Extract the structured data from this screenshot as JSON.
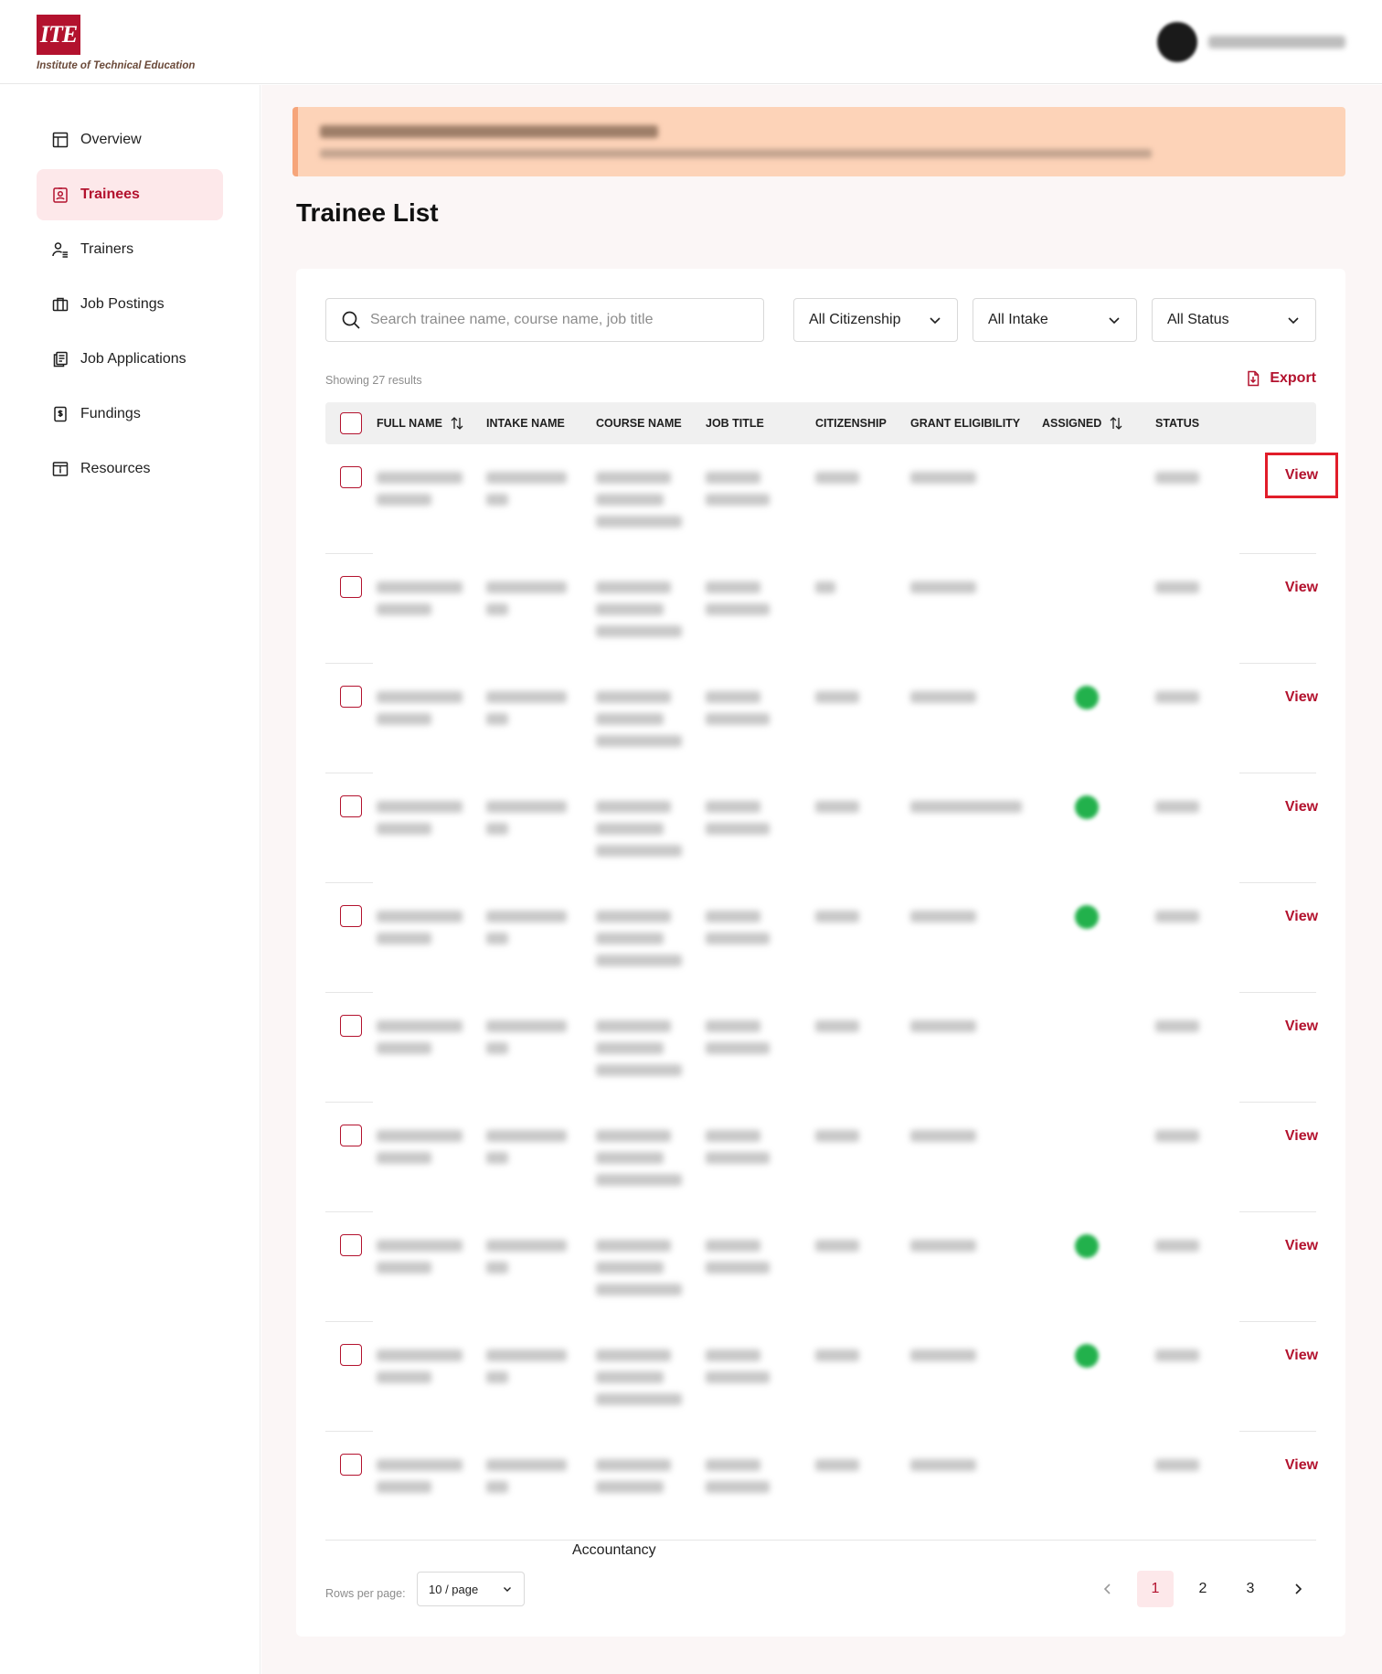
{
  "brand": {
    "logo_text": "ITE",
    "subtitle": "Institute of Technical Education",
    "accent": "#b3122e"
  },
  "sidebar": {
    "items": [
      {
        "label": "Overview",
        "icon": "layout-icon",
        "active": false
      },
      {
        "label": "Trainees",
        "icon": "id-badge-icon",
        "active": true
      },
      {
        "label": "Trainers",
        "icon": "user-list-icon",
        "active": false
      },
      {
        "label": "Job Postings",
        "icon": "briefcase-icon",
        "active": false
      },
      {
        "label": "Job Applications",
        "icon": "documents-icon",
        "active": false
      },
      {
        "label": "Fundings",
        "icon": "dollar-document-icon",
        "active": false
      },
      {
        "label": "Resources",
        "icon": "info-board-icon",
        "active": false
      }
    ]
  },
  "main": {
    "title": "Trainee List",
    "search": {
      "placeholder": "Search trainee name, course name, job title",
      "value": ""
    },
    "filters": [
      "All Citizenship",
      "All Intake",
      "All Status"
    ],
    "showing": "Showing 27 results",
    "export_label": "Export",
    "columns": [
      "Full Name",
      "Intake Name",
      "Course Name",
      "Job Title",
      "Citizenship",
      "Grant Eligibility",
      "Assigned",
      "Status"
    ],
    "view_label": "View",
    "assigned_rows": [
      2,
      3,
      4,
      7,
      8
    ],
    "stray_text": "Accountancy",
    "pagination": {
      "rows_per_page_label": "Rows per page:",
      "page_size": "10 / page",
      "pages": [
        "1",
        "2",
        "3"
      ],
      "current": "1"
    }
  }
}
